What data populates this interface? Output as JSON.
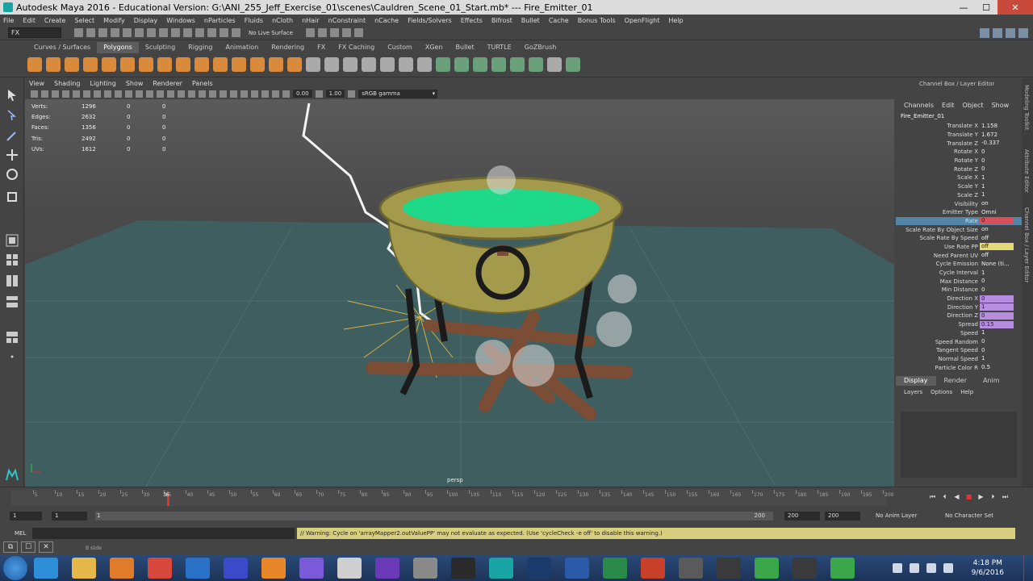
{
  "titlebar": {
    "title": "Autodesk Maya 2016 - Educational Version: G:\\ANI_255_Jeff_Exercise_01\\scenes\\Cauldren_Scene_01_Start.mb*   ---   Fire_Emitter_01",
    "minimize": "—",
    "maximize": "☐",
    "close": "✕"
  },
  "menus": [
    "File",
    "Edit",
    "Create",
    "Select",
    "Modify",
    "Display",
    "Windows",
    "nParticles",
    "Fluids",
    "nCloth",
    "nHair",
    "nConstraint",
    "nCache",
    "Fields/Solvers",
    "Effects",
    "Bifrost",
    "Bullet",
    "Cache",
    "Bonus Tools",
    "OpenFlight",
    "Help"
  ],
  "statusline": {
    "mode": "FX",
    "live_surface": "No Live Surface"
  },
  "shelf_tabs": [
    "Curves / Surfaces",
    "Polygons",
    "Sculpting",
    "Rigging",
    "Animation",
    "Rendering",
    "FX",
    "FX Caching",
    "Custom",
    "XGen",
    "Bullet",
    "TURTLE",
    "GoZBrush"
  ],
  "panel_menu": [
    "View",
    "Shading",
    "Lighting",
    "Show",
    "Renderer",
    "Panels"
  ],
  "panel_toolbar": {
    "exposure": "0.00",
    "gamma_value": "1.00",
    "color_space": "sRGB gamma"
  },
  "hud": [
    {
      "label": "Verts:",
      "v1": "1296",
      "v2": "0",
      "v3": "0"
    },
    {
      "label": "Edges:",
      "v1": "2632",
      "v2": "0",
      "v3": "0"
    },
    {
      "label": "Faces:",
      "v1": "1356",
      "v2": "0",
      "v3": "0"
    },
    {
      "label": "Tris:",
      "v1": "2492",
      "v2": "0",
      "v3": "0"
    },
    {
      "label": "UVs:",
      "v1": "1612",
      "v2": "0",
      "v3": "0"
    }
  ],
  "viewport": {
    "camera": "persp",
    "pool_color": "#1ed98a",
    "bowl_color": "#a39a4c"
  },
  "channel_box": {
    "header": "Channel Box / Layer Editor",
    "menus": [
      "Channels",
      "Edit",
      "Object",
      "Show"
    ],
    "object": "Fire_Emitter_01",
    "attributes": [
      {
        "label": "Translate X",
        "value": "1.158"
      },
      {
        "label": "Translate Y",
        "value": "1.672"
      },
      {
        "label": "Translate Z",
        "value": "-0.337"
      },
      {
        "label": "Rotate X",
        "value": "0"
      },
      {
        "label": "Rotate Y",
        "value": "0"
      },
      {
        "label": "Rotate Z",
        "value": "0"
      },
      {
        "label": "Scale X",
        "value": "1"
      },
      {
        "label": "Scale Y",
        "value": "1"
      },
      {
        "label": "Scale Z",
        "value": "1"
      },
      {
        "label": "Visibility",
        "value": "on"
      },
      {
        "label": "Emitter Type",
        "value": "Omni"
      },
      {
        "label": "Rate",
        "value": "0",
        "state": "keyed",
        "selected": true
      },
      {
        "label": "Scale Rate By Object Size",
        "value": "on"
      },
      {
        "label": "Scale Rate By Speed",
        "value": "off"
      },
      {
        "label": "Use Rate PP",
        "value": "off",
        "state": "connected"
      },
      {
        "label": "Need Parent UV",
        "value": "off"
      },
      {
        "label": "Cycle Emission",
        "value": "None (ti..."
      },
      {
        "label": "Cycle Interval",
        "value": "1"
      },
      {
        "label": "Max Distance",
        "value": "0"
      },
      {
        "label": "Min Distance",
        "value": "0"
      },
      {
        "label": "Direction X",
        "value": "0",
        "state": "expression"
      },
      {
        "label": "Direction Y",
        "value": "1",
        "state": "expression"
      },
      {
        "label": "Direction Z",
        "value": "0",
        "state": "expression"
      },
      {
        "label": "Spread",
        "value": "0.15",
        "state": "expression"
      },
      {
        "label": "Speed",
        "value": "1"
      },
      {
        "label": "Speed Random",
        "value": "0"
      },
      {
        "label": "Tangent Speed",
        "value": "0"
      },
      {
        "label": "Normal Speed",
        "value": "1"
      },
      {
        "label": "Particle Color R",
        "value": "0.5"
      }
    ],
    "state_colors": {
      "keyed": "#d9505a",
      "connected": "#e6d97a",
      "expression": "#b68de0"
    }
  },
  "side_tabs": [
    "Modeling Toolkit",
    "Attribute Editor",
    "Channel Box / Layer Editor"
  ],
  "layer_editor": {
    "tabs": [
      "Display",
      "Render",
      "Anim"
    ],
    "menus": [
      "Layers",
      "Options",
      "Help"
    ]
  },
  "timeline": {
    "current_frame": "36",
    "ticks": [
      "5",
      "10",
      "15",
      "20",
      "25",
      "30",
      "35",
      "40",
      "45",
      "50",
      "55",
      "60",
      "65",
      "70",
      "75",
      "80",
      "85",
      "90",
      "95",
      "100",
      "105",
      "110",
      "115",
      "120",
      "125",
      "130",
      "135",
      "140",
      "145",
      "150",
      "155",
      "160",
      "165",
      "170",
      "175",
      "180",
      "185",
      "190",
      "195",
      "200"
    ],
    "playback_buttons": [
      "⏮",
      "⏴",
      "◀",
      "■",
      "▶",
      "⏵",
      "⏭"
    ]
  },
  "range": {
    "start": "1",
    "playback_start": "1",
    "bar_start": "1",
    "bar_end": "200",
    "playback_end": "200",
    "end": "200",
    "anim_layer": "No Anim Layer",
    "character_set": "No Character Set"
  },
  "command_line": {
    "label": "MEL",
    "warning": "// Warning: Cycle on 'arrayMapper2.outValuePP' may not evaluate as expected.  (Use 'cycleCheck -e off' to disable this warning.)"
  },
  "help_line": {
    "text": "B slide"
  },
  "taskbar": {
    "time": "4:18 PM",
    "date": "9/6/2016",
    "apps": [
      "internet-explorer",
      "file-explorer",
      "media-player",
      "chrome",
      "outlook",
      "autodesk-app",
      "blender",
      "xnview",
      "unity-gnome",
      "visual-studio",
      "calculator",
      "epic-games",
      "maya",
      "photoshop",
      "word",
      "excel",
      "powerpoint",
      "zbrush",
      "media-center",
      "camtasia",
      "udk",
      "camtasia-recorder"
    ]
  }
}
